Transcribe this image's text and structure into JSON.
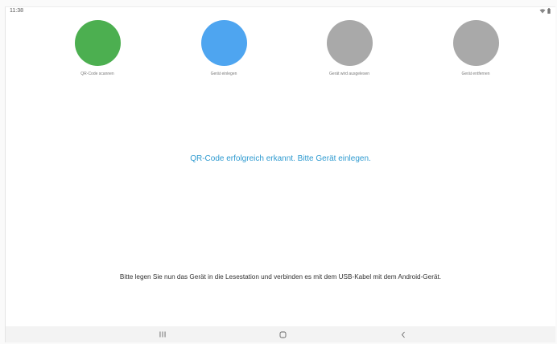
{
  "status_bar": {
    "time": "11:38"
  },
  "steps": [
    {
      "label": "QR-Code scannen",
      "color": "#4caf50"
    },
    {
      "label": "Gerät einlegen",
      "color": "#4ea5f0"
    },
    {
      "label": "Gerät wird ausgelesen",
      "color": "#a9a9a9"
    },
    {
      "label": "Gerät entfernen",
      "color": "#a9a9a9"
    }
  ],
  "main": {
    "status_message": "QR-Code erfolgreich erkannt. Bitte Gerät einlegen.",
    "instruction": "Bitte legen Sie nun das Gerät in die Lesestation und verbinden es mit dem USB-Kabel mit dem Android-Gerät."
  },
  "nav_bar": {
    "icons": [
      "recent-apps-icon",
      "home-icon",
      "back-icon"
    ]
  }
}
